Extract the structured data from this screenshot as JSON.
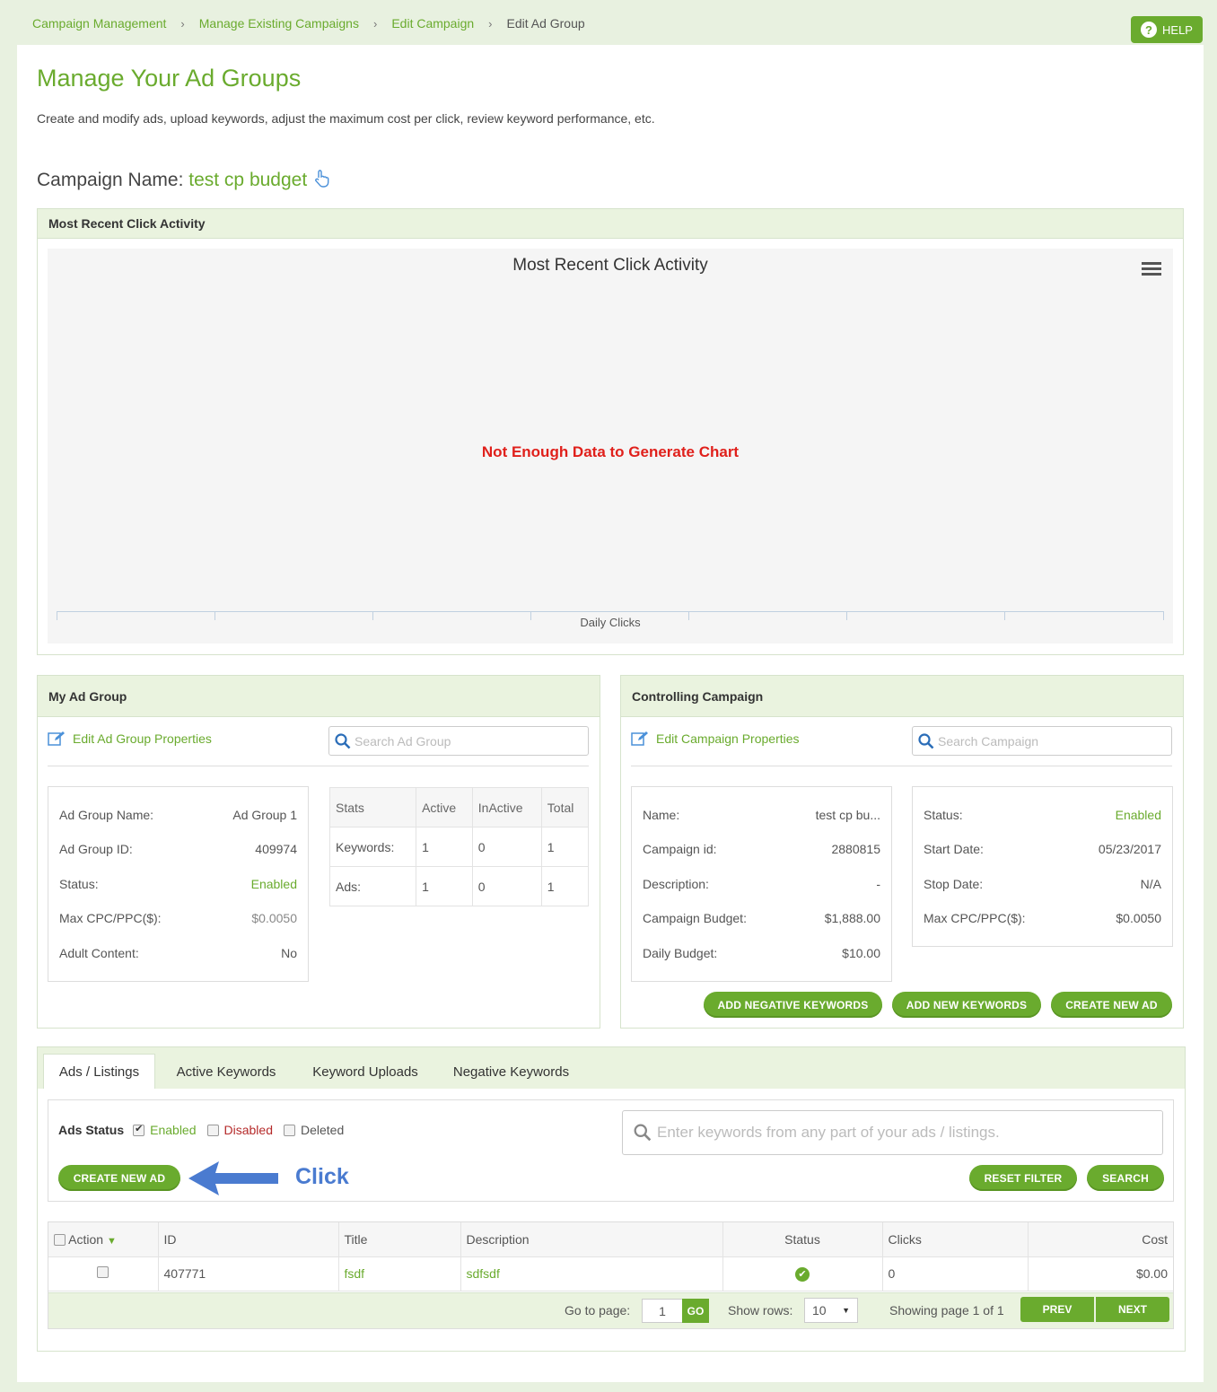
{
  "breadcrumb": [
    "Campaign Management",
    "Manage Existing Campaigns",
    "Edit Campaign",
    "Edit Ad Group"
  ],
  "help_label": "HELP",
  "page": {
    "title": "Manage Your Ad Groups",
    "subtitle": "Create and modify ads, upload keywords, adjust the maximum cost per click, review keyword performance, etc.",
    "campaign_label": "Campaign Name:",
    "campaign_name": "test cp budget"
  },
  "chart_panel": {
    "heading": "Most Recent Click Activity",
    "chart_title": "Most Recent Click Activity",
    "no_data": "Not Enough Data to Generate Chart",
    "x_label": "Daily Clicks"
  },
  "chart_data": {
    "type": "line",
    "title": "Most Recent Click Activity",
    "xlabel": "Daily Clicks",
    "ylabel": "",
    "series": [],
    "message": "Not Enough Data to Generate Chart"
  },
  "ad_group": {
    "heading": "My Ad Group",
    "edit_link": "Edit Ad Group Properties",
    "search_placeholder": "Search Ad Group",
    "fields": [
      {
        "label": "Ad Group Name:",
        "value": "Ad Group 1"
      },
      {
        "label": "Ad Group ID:",
        "value": "409974"
      },
      {
        "label": "Status:",
        "value": "Enabled"
      },
      {
        "label": "Max CPC/PPC($):",
        "value": "$0.0050"
      },
      {
        "label": "Adult Content:",
        "value": "No"
      }
    ],
    "stats": {
      "headers": [
        "Stats",
        "Active",
        "InActive",
        "Total"
      ],
      "rows": [
        [
          "Keywords:",
          "1",
          "0",
          "1"
        ],
        [
          "Ads:",
          "1",
          "0",
          "1"
        ]
      ]
    }
  },
  "campaign": {
    "heading": "Controlling Campaign",
    "edit_link": "Edit Campaign Properties",
    "search_placeholder": "Search Campaign",
    "left_fields": [
      {
        "label": "Name:",
        "value": "test cp bu..."
      },
      {
        "label": "Campaign id:",
        "value": "2880815"
      },
      {
        "label": "Description:",
        "value": "-"
      },
      {
        "label": "Campaign Budget:",
        "value": "$1,888.00"
      },
      {
        "label": "Daily Budget:",
        "value": "$10.00"
      }
    ],
    "right_fields": [
      {
        "label": "Status:",
        "value": "Enabled"
      },
      {
        "label": "Start Date:",
        "value": "05/23/2017"
      },
      {
        "label": "Stop Date:",
        "value": "N/A"
      },
      {
        "label": "Max CPC/PPC($):",
        "value": "$0.0050"
      }
    ],
    "buttons": [
      "ADD NEGATIVE KEYWORDS",
      "ADD NEW KEYWORDS",
      "CREATE NEW AD"
    ]
  },
  "tabs": [
    "Ads / Listings",
    "Active Keywords",
    "Keyword Uploads",
    "Negative Keywords"
  ],
  "ads": {
    "status_label": "Ads Status",
    "filters": [
      {
        "label": "Enabled",
        "checked": true,
        "color": "#6aab2e"
      },
      {
        "label": "Disabled",
        "checked": false,
        "color": "#b52a2a"
      },
      {
        "label": "Deleted",
        "checked": false,
        "color": "#555555"
      }
    ],
    "search_placeholder": "Enter keywords from any part of your ads / listings.",
    "create_button": "CREATE NEW AD",
    "annotation": "Click",
    "reset_button": "RESET FILTER",
    "search_button": "SEARCH",
    "columns": [
      "Action",
      "ID",
      "Title",
      "Description",
      "Status",
      "Clicks",
      "Cost"
    ],
    "rows": [
      {
        "id": "407771",
        "title": "fsdf",
        "description": "sdfsdf",
        "status": "enabled",
        "clicks": "0",
        "cost": "$0.00"
      }
    ],
    "pager": {
      "go_to_label": "Go to page:",
      "page_value": "1",
      "go_button": "GO",
      "rows_label": "Show rows:",
      "rows_value": "10",
      "showing": "Showing page 1 of 1",
      "prev": "PREV",
      "next": "NEXT"
    }
  }
}
